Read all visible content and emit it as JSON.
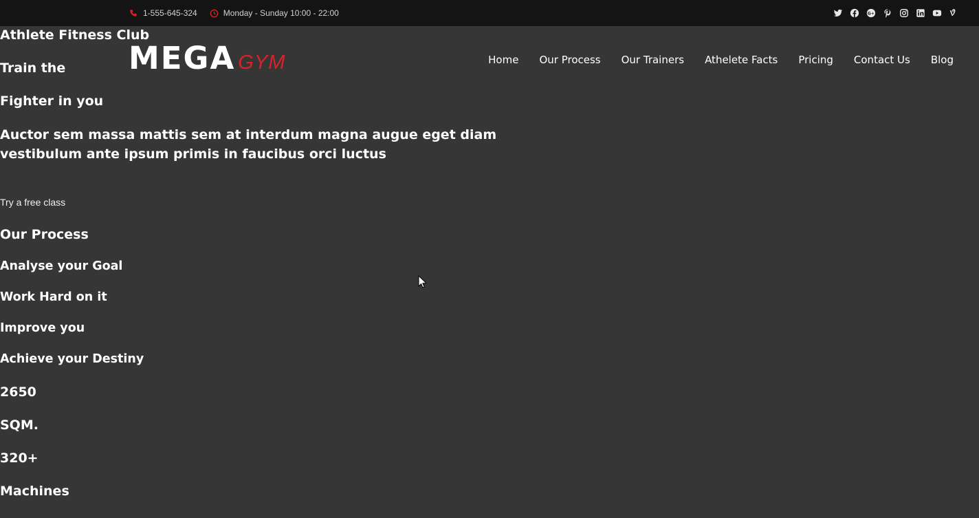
{
  "topbar": {
    "phone": "1-555-645-324",
    "hours": "Monday - Sunday 10:00 - 22:00",
    "social_icons": [
      "twitter-icon",
      "facebook-icon",
      "google-plus-icon",
      "pinterest-icon",
      "instagram-icon",
      "linkedin-icon",
      "youtube-icon",
      "vine-icon"
    ]
  },
  "logo": {
    "main": "MEGA",
    "accent": "GYM"
  },
  "nav": {
    "items": [
      "Home",
      "Our Process",
      "Our Trainers",
      "Athelete Facts",
      "Pricing",
      "Contact Us",
      "Blog"
    ]
  },
  "hero": {
    "tagline": "Athlete Fitness Club",
    "title_line1": "Train the",
    "title_line2": "Fighter in you",
    "description_line1": "Auctor sem massa mattis sem at interdum magna augue eget diam",
    "description_line2": "vestibulum ante ipsum primis in faucibus orci luctus",
    "cta": "Try a free class"
  },
  "process": {
    "heading": "Our Process",
    "steps": [
      "Analyse your Goal",
      "Work Hard on it",
      "Improve you",
      "Achieve your Destiny"
    ]
  },
  "facts": [
    {
      "value": "2650",
      "label": "SQM."
    },
    {
      "value": "320+",
      "label": "Machines"
    }
  ],
  "colors": {
    "accent": "#d8232a",
    "background": "#363636",
    "topbar": "#141414"
  }
}
